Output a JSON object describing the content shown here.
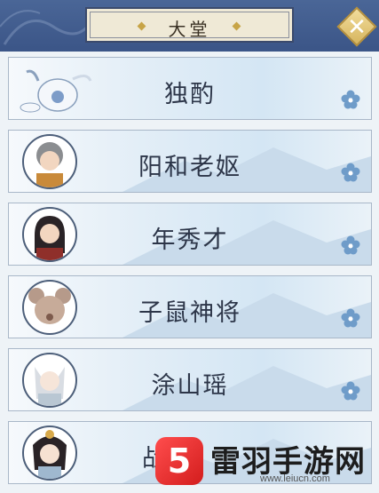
{
  "header": {
    "title": "大堂",
    "close_icon": "close-x-icon"
  },
  "rows": [
    {
      "name": "独酌",
      "icon": "wine-jar-icon"
    },
    {
      "name": "阳和老妪",
      "icon": "old-woman-avatar"
    },
    {
      "name": "年秀才",
      "icon": "scholar-avatar"
    },
    {
      "name": "子鼠神将",
      "icon": "rat-general-avatar"
    },
    {
      "name": "涂山瑶",
      "icon": "fox-girl-avatar"
    },
    {
      "name": "战",
      "icon": "lady-avatar"
    }
  ],
  "watermark": {
    "brand": "雷羽手游网",
    "url": "www.leiucn.com",
    "logo": "5"
  },
  "colors": {
    "header_bg": "#4a6697",
    "accent_gold": "#c7a447",
    "row_bg": "#d4e6f4",
    "text": "#2c3548"
  }
}
